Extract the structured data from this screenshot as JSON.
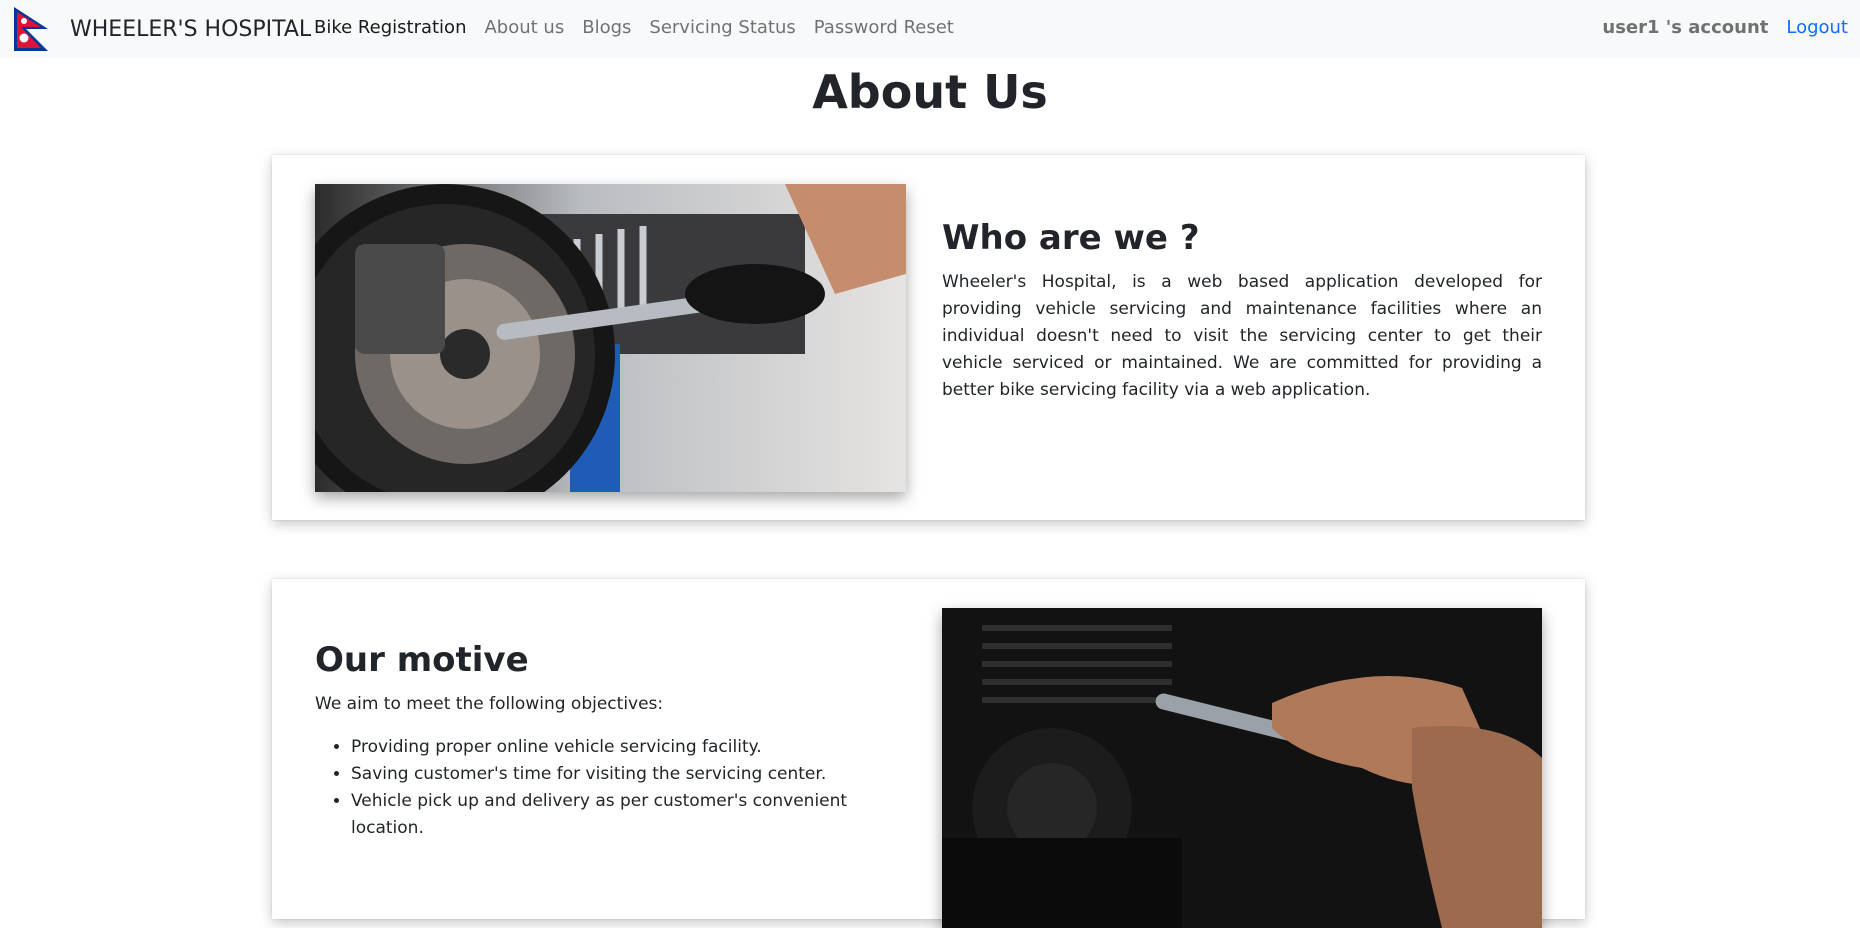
{
  "navbar": {
    "brand": "WHEELER'S HOSPITAL",
    "links": [
      {
        "label": "Bike Registration",
        "active": true
      },
      {
        "label": "About us",
        "active": false
      },
      {
        "label": "Blogs",
        "active": false
      },
      {
        "label": "Servicing Status",
        "active": false
      },
      {
        "label": "Password Reset",
        "active": false
      }
    ],
    "account": "user1 's account",
    "logout": "Logout"
  },
  "page": {
    "title": "About Us"
  },
  "who": {
    "heading": "Who are we ?",
    "body": "Wheeler's Hospital, is a web based application developed for providing vehicle servicing and maintenance facilities where an individual doesn't need to visit the servicing center to get their vehicle serviced or maintained. We are committed for providing a better bike servicing facility via a web application."
  },
  "motive": {
    "heading": "Our motive",
    "intro": "We aim to meet the following objectives:",
    "objectives": [
      "Providing proper online vehicle servicing facility.",
      "Saving customer's time for visiting the servicing center.",
      "Vehicle pick up and delivery as per customer's convenient location."
    ]
  },
  "colors": {
    "navbar_bg": "#f8f9fa",
    "link_blue": "#0d6efd",
    "flag_red": "#dc143c",
    "flag_blue": "#003893"
  },
  "icons": {
    "brand_logo": "nepal-flag-icon"
  }
}
